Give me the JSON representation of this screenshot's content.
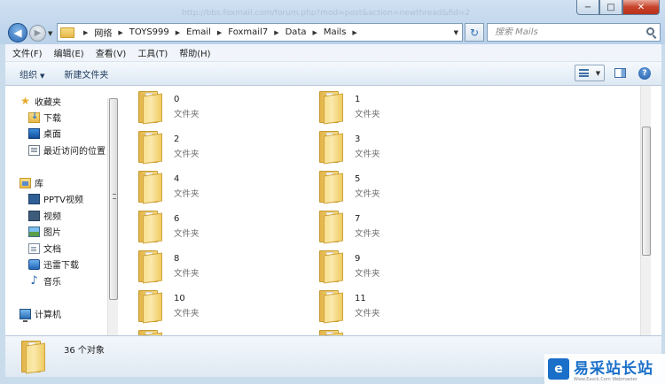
{
  "window": {
    "ghost_title": "http://bbs.foxmail.com/forum.php?mod=post&action=newthread&fid=2",
    "min": "−",
    "max": "□",
    "close": "✕"
  },
  "address": {
    "crumbs": [
      "网络",
      "TOYS999",
      "Email",
      "Foxmail7",
      "Data",
      "Mails"
    ],
    "search_placeholder": "搜索 Mails"
  },
  "menu": [
    "文件(F)",
    "编辑(E)",
    "查看(V)",
    "工具(T)",
    "帮助(H)"
  ],
  "toolbar": {
    "organize": "组织",
    "new_folder": "新建文件夹"
  },
  "navpane": {
    "favorites": "收藏夹",
    "downloads": "下载",
    "desktop": "桌面",
    "recent": "最近访问的位置",
    "libraries": "库",
    "pptv": "PPTV视频",
    "videos": "视频",
    "pictures": "图片",
    "documents": "文档",
    "thunder": "迅雷下载",
    "music": "音乐",
    "computer": "计算机"
  },
  "folders": [
    {
      "name": "0",
      "type": "文件夹"
    },
    {
      "name": "1",
      "type": "文件夹"
    },
    {
      "name": "2",
      "type": "文件夹"
    },
    {
      "name": "3",
      "type": "文件夹"
    },
    {
      "name": "4",
      "type": "文件夹"
    },
    {
      "name": "5",
      "type": "文件夹"
    },
    {
      "name": "6",
      "type": "文件夹"
    },
    {
      "name": "7",
      "type": "文件夹"
    },
    {
      "name": "8",
      "type": "文件夹"
    },
    {
      "name": "9",
      "type": "文件夹"
    },
    {
      "name": "10",
      "type": "文件夹"
    },
    {
      "name": "11",
      "type": "文件夹"
    }
  ],
  "details": {
    "count": "36 个对象"
  },
  "watermark": {
    "logo": "e",
    "text": "易采站长站",
    "sub": "Www.Easck.Com Webmaster"
  },
  "colors": {
    "accent": "#1a6fc8",
    "titlebar": "#b9d1ea",
    "folder": "#f5d97f"
  }
}
